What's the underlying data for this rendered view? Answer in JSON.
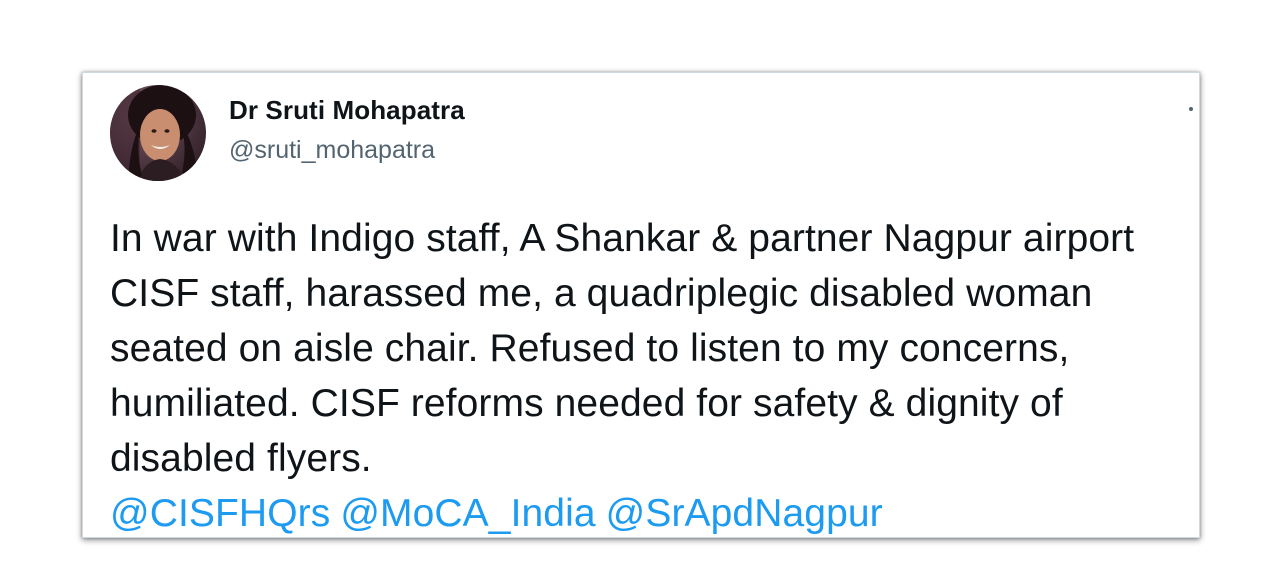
{
  "tweet": {
    "author": {
      "display_name": "Dr Sruti Mohapatra",
      "handle": "@sruti_mohapatra"
    },
    "text": "In war with Indigo staff, A Shankar & partner Nagpur airport CISF staff, harassed me, a quadriplegic disabled woman seated on aisle chair. Refused to listen to my concerns, humiliated. CISF reforms needed for safety & dignity of disabled flyers.",
    "mentions": [
      "@CISFHQrs",
      "@MoCA_India",
      "@SrApdNagpur"
    ],
    "menu_icon": "more-dots-icon",
    "colors": {
      "text": "#0f1419",
      "secondary": "#536471",
      "link": "#1d9bf0"
    }
  }
}
